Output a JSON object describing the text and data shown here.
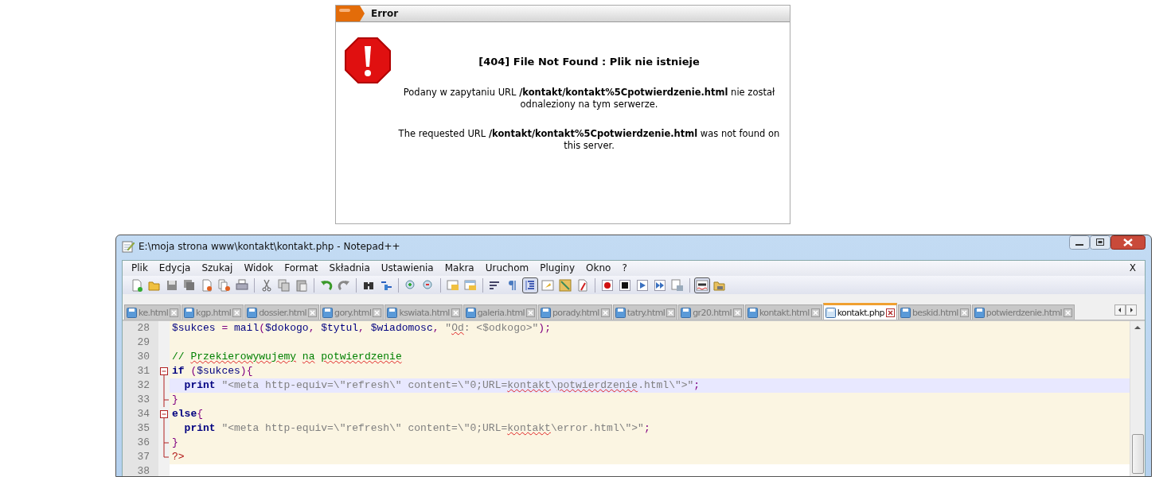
{
  "error_page": {
    "title": "Error",
    "heading": "[404] File Not Found : Plik nie istnieje",
    "messages": [
      "Podany w zapytaniu URL **/kontakt/kontakt%5Cpotwierdzenie.html** nie został odnaleziony na tym serwerze.",
      "The requested URL **/kontakt/kontakt%5Cpotwierdzenie.html** was not found on this server."
    ]
  },
  "window": {
    "title": "E:\\moja strona www\\kontakt\\kontakt.php - Notepad++"
  },
  "menu": [
    "Plik",
    "Edycja",
    "Szukaj",
    "Widok",
    "Format",
    "Składnia",
    "Ustawienia",
    "Makra",
    "Uruchom",
    "Pluginy",
    "Okno",
    "?"
  ],
  "menu_close": "X",
  "toolbar": [
    {
      "kind": "button",
      "pressed": false
    },
    {
      "kind": "button",
      "pressed": false
    },
    {
      "kind": "button",
      "pressed": false
    },
    {
      "kind": "button",
      "pressed": false
    },
    {
      "kind": "button",
      "pressed": false
    },
    {
      "kind": "button",
      "pressed": false
    },
    {
      "kind": "button",
      "pressed": false
    },
    {
      "kind": "separator"
    },
    {
      "kind": "button",
      "pressed": false
    },
    {
      "kind": "button",
      "pressed": false
    },
    {
      "kind": "button",
      "pressed": false
    },
    {
      "kind": "separator"
    },
    {
      "kind": "button",
      "pressed": false
    },
    {
      "kind": "button",
      "pressed": false
    },
    {
      "kind": "separator"
    },
    {
      "kind": "button",
      "pressed": false
    },
    {
      "kind": "button",
      "pressed": false
    },
    {
      "kind": "separator"
    },
    {
      "kind": "button",
      "pressed": false
    },
    {
      "kind": "button",
      "pressed": false
    },
    {
      "kind": "separator"
    },
    {
      "kind": "button",
      "pressed": false
    },
    {
      "kind": "button",
      "pressed": false
    },
    {
      "kind": "separator"
    },
    {
      "kind": "button",
      "pressed": false
    },
    {
      "kind": "button",
      "pressed": false
    },
    {
      "kind": "button",
      "pressed": true
    },
    {
      "kind": "button",
      "pressed": false
    },
    {
      "kind": "button",
      "pressed": false
    },
    {
      "kind": "button",
      "pressed": false
    },
    {
      "kind": "separator"
    },
    {
      "kind": "button",
      "pressed": false
    },
    {
      "kind": "button",
      "pressed": false
    },
    {
      "kind": "button",
      "pressed": false
    },
    {
      "kind": "button",
      "pressed": false
    },
    {
      "kind": "button",
      "pressed": false
    },
    {
      "kind": "separator"
    },
    {
      "kind": "button",
      "pressed": true
    },
    {
      "kind": "button",
      "pressed": false
    }
  ],
  "tabs": [
    {
      "label": "ke.html",
      "selected": false
    },
    {
      "label": "kgp.html",
      "selected": false
    },
    {
      "label": "dossier.html",
      "selected": false
    },
    {
      "label": "gory.html",
      "selected": false
    },
    {
      "label": "kswiata.html",
      "selected": false
    },
    {
      "label": "galeria.html",
      "selected": false
    },
    {
      "label": "porady.html",
      "selected": false
    },
    {
      "label": "tatry.html",
      "selected": false
    },
    {
      "label": "gr20.html",
      "selected": false
    },
    {
      "label": "kontakt.html",
      "selected": false
    },
    {
      "label": "kontakt.php",
      "selected": true
    },
    {
      "label": "beskid.html",
      "selected": false
    },
    {
      "label": "potwierdzenie.html",
      "selected": false
    }
  ],
  "editor": {
    "lines": [
      {
        "number": "28",
        "current": false,
        "in_php": true,
        "tokens": [
          {
            "kind": "var",
            "text": "$sukces"
          },
          {
            "kind": "op",
            "text": " = "
          },
          {
            "kind": "fn",
            "text": "mail"
          },
          {
            "kind": "op",
            "text": "("
          },
          {
            "kind": "var",
            "text": "$dokogo"
          },
          {
            "kind": "op",
            "text": ", "
          },
          {
            "kind": "var",
            "text": "$tytul"
          },
          {
            "kind": "op",
            "text": ", "
          },
          {
            "kind": "var",
            "text": "$wiadomosc"
          },
          {
            "kind": "op",
            "text": ", "
          },
          {
            "kind": "str",
            "text": "\""
          },
          {
            "kind": "str",
            "text": "Od",
            "misspelled": true
          },
          {
            "kind": "str",
            "text": ": <$odkogo>\""
          },
          {
            "kind": "op",
            "text": ");"
          }
        ]
      },
      {
        "number": "29",
        "current": false,
        "in_php": true
      },
      {
        "number": "30",
        "current": false,
        "in_php": true,
        "tokens": [
          {
            "kind": "comment",
            "text": "//"
          },
          {
            "kind": "comment",
            "text": "Przekierowywujemy",
            "misspelled": true,
            "space_before": true
          },
          {
            "kind": "comment",
            "text": "na",
            "misspelled": true,
            "space_before": true
          },
          {
            "kind": "comment",
            "text": "potwierdzenie",
            "misspelled": true,
            "space_before": true
          }
        ]
      },
      {
        "number": "31",
        "current": false,
        "in_php": true,
        "kind": "fold-start",
        "tokens": [
          {
            "kind": "kw",
            "text": "if"
          },
          {
            "kind": "op",
            "text": " ("
          },
          {
            "kind": "var",
            "text": "$sukces"
          },
          {
            "kind": "op",
            "text": "){"
          }
        ]
      },
      {
        "number": "32",
        "current": true,
        "in_php": true,
        "kind": "fold-body",
        "tokens": [
          {
            "kind": "kw",
            "text": "  print"
          },
          {
            "kind": "str",
            "text": " \"<meta http-equiv=\\\"refresh\\\" content=\\\"0;URL="
          },
          {
            "kind": "str",
            "text": "kontakt",
            "misspelled": true
          },
          {
            "kind": "str",
            "text": "\\"
          },
          {
            "kind": "str",
            "text": "potwierdzenie",
            "misspelled": true
          },
          {
            "kind": "str",
            "text": ".html\\\">\""
          },
          {
            "kind": "op",
            "text": ";"
          }
        ]
      },
      {
        "number": "33",
        "current": false,
        "in_php": true,
        "kind": "fold-end",
        "tokens": [
          {
            "kind": "op",
            "text": "}"
          }
        ]
      },
      {
        "number": "34",
        "current": false,
        "in_php": true,
        "kind": "fold-start",
        "tokens": [
          {
            "kind": "kw",
            "text": "else"
          },
          {
            "kind": "op",
            "text": "{"
          }
        ]
      },
      {
        "number": "35",
        "current": false,
        "in_php": true,
        "kind": "fold-body",
        "tokens": [
          {
            "kind": "kw",
            "text": "  print"
          },
          {
            "kind": "str",
            "text": " \"<meta http-equiv=\\\"refresh\\\" content=\\\"0;URL="
          },
          {
            "kind": "str",
            "text": "kontakt",
            "misspelled": true
          },
          {
            "kind": "str",
            "text": "\\error.html\\\">\""
          },
          {
            "kind": "op",
            "text": ";"
          }
        ]
      },
      {
        "number": "36",
        "current": false,
        "in_php": true,
        "kind": "fold-end",
        "tokens": [
          {
            "kind": "op",
            "text": "}"
          }
        ]
      },
      {
        "number": "37",
        "current": false,
        "in_php": true,
        "kind": "fold-last",
        "tokens": [
          {
            "kind": "php",
            "text": "?>"
          }
        ]
      },
      {
        "number": "38",
        "current": false,
        "in_php": false
      }
    ]
  }
}
